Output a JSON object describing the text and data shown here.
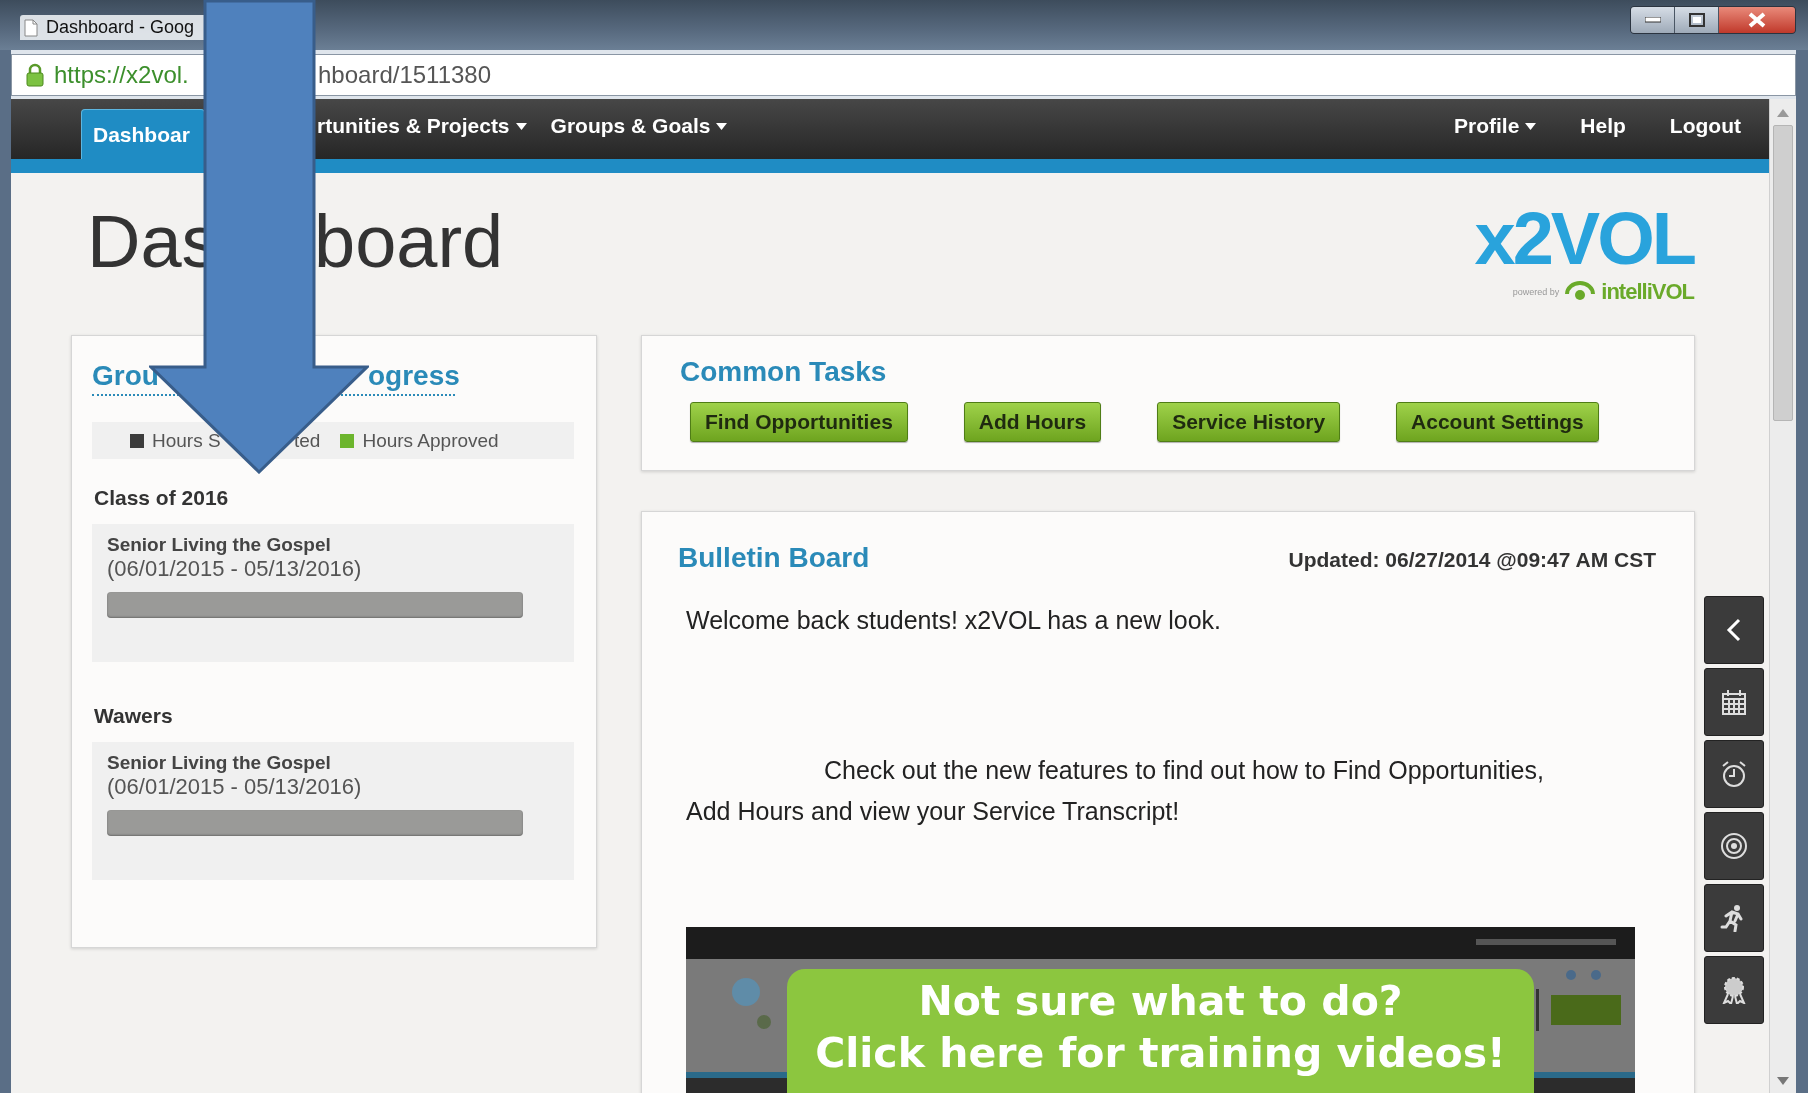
{
  "window": {
    "title": "Dashboard - Goog"
  },
  "address_bar": {
    "url_parts": [
      "https://x2vol.",
      "hboard/1511380"
    ]
  },
  "nav": {
    "left": [
      {
        "label": "Dashboar",
        "selected": true,
        "dropdown": false
      },
      {
        "label": "rtunities & Projects",
        "selected": false,
        "dropdown": true
      },
      {
        "label": "Groups & Goals",
        "selected": false,
        "dropdown": true
      }
    ],
    "right": [
      {
        "label": "Profile",
        "selected": false,
        "dropdown": true
      },
      {
        "label": "Help",
        "selected": false,
        "dropdown": false
      },
      {
        "label": "Logout",
        "selected": false,
        "dropdown": false
      }
    ]
  },
  "page": {
    "heading_parts": [
      "Das",
      "board"
    ],
    "logo": {
      "name": "x2VOL",
      "tagline": "powered by",
      "partner": "intelliVOL"
    }
  },
  "groups_panel": {
    "title_parts": [
      "Grou",
      "ogress"
    ],
    "legend": [
      {
        "label_parts": [
          "Hours S",
          "ted"
        ],
        "color": "#3c3c3c"
      },
      {
        "label_parts": [
          "Hours Approved"
        ],
        "color": "#6cb52d"
      }
    ],
    "groups": [
      {
        "name": "Class of 2016",
        "items": [
          {
            "title": "Senior Living the Gospel",
            "dates": "(06/01/2015 - 05/13/2016)",
            "level": 0
          }
        ]
      },
      {
        "name": "Wawers",
        "items": [
          {
            "title": "Senior Living the Gospel",
            "dates": "(06/01/2015 - 05/13/2016)",
            "level": 0
          }
        ]
      }
    ]
  },
  "common_tasks": {
    "title": "Common Tasks",
    "buttons": [
      "Find Opportunities",
      "Add Hours",
      "Service History",
      "Account Settings"
    ]
  },
  "bulletin": {
    "title": "Bulletin Board",
    "updated": "Updated: 06/27/2014 @09:47 AM CST",
    "paragraphs": [
      {
        "text": "Welcome back students! x2VOL has a new look.",
        "indented": false
      },
      {
        "text": "Check out the new features to find out how to Find Opportunities, Add Hours and view your Service Transcript!",
        "indented": true
      }
    ],
    "video": {
      "kind": "picture",
      "banner_lines": [
        "Not sure what to do?",
        "Click here for training videos!"
      ]
    }
  },
  "side_tools": [
    {
      "kind": "collapse"
    },
    {
      "kind": "calendar"
    },
    {
      "kind": "alarm"
    },
    {
      "kind": "target"
    },
    {
      "kind": "runner"
    },
    {
      "kind": "award"
    }
  ],
  "overlay": {
    "kind": "arrow"
  }
}
